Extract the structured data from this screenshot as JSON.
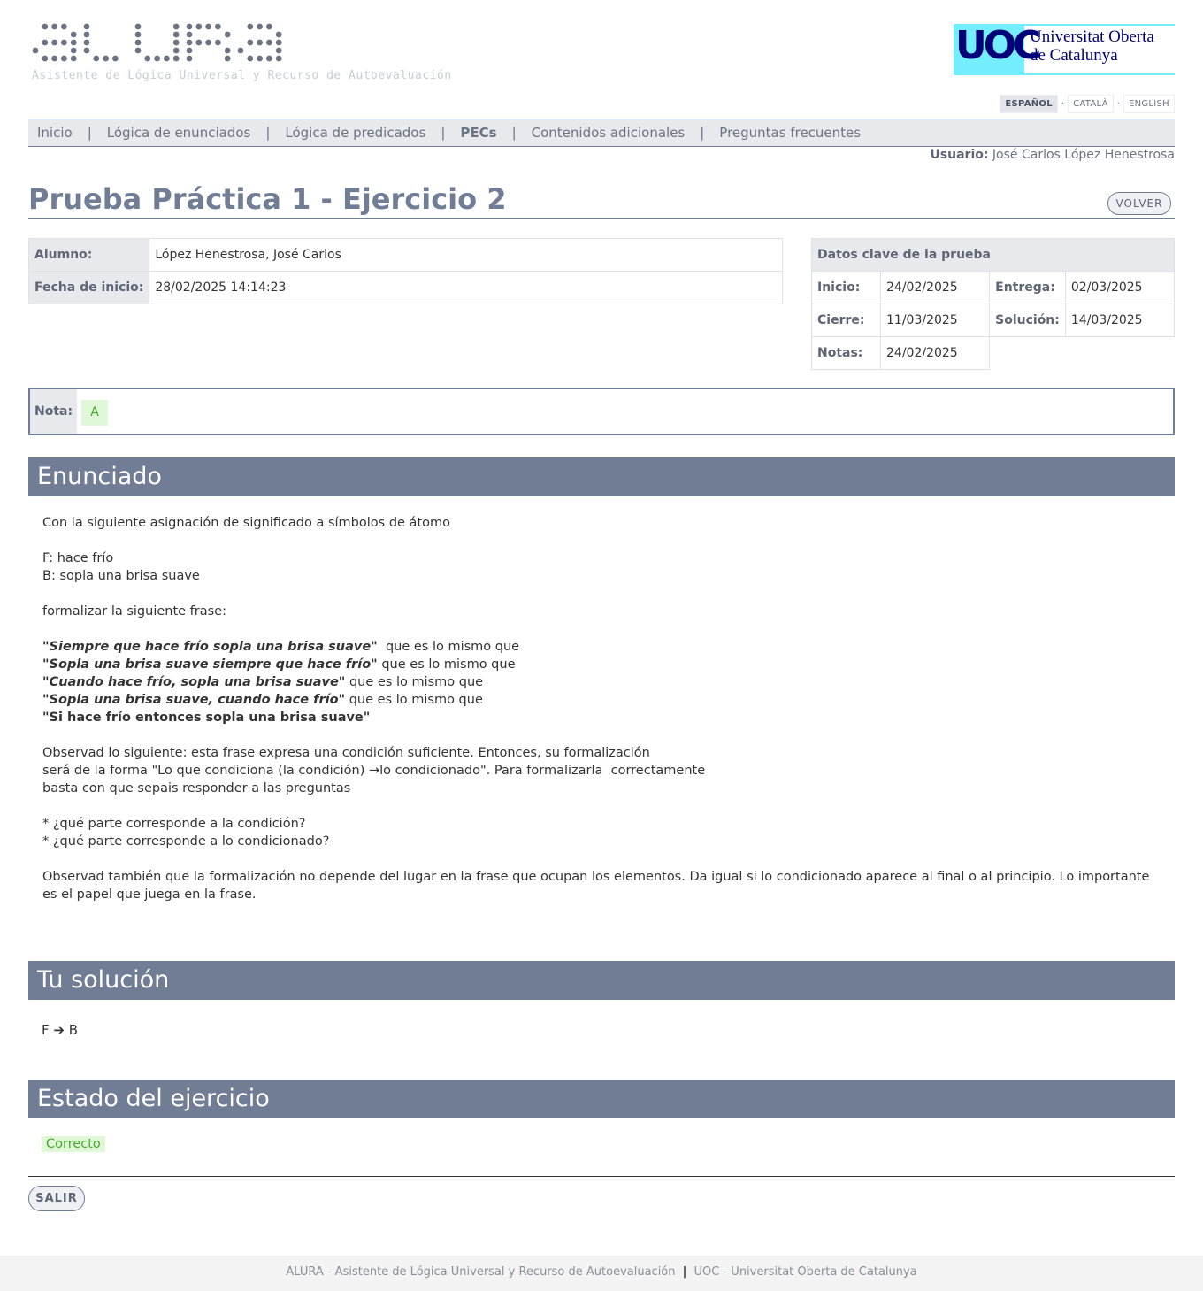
{
  "header": {
    "logo_text": "ALURA",
    "logo_subtitle": "Asistente de Lógica Universal y Recurso de Autoevaluación",
    "uoc_mark": "UOC",
    "uoc_name_line1": "Universitat Oberta",
    "uoc_name_line2": "de Catalunya",
    "languages": [
      "ESPAÑOL",
      "CATALÀ",
      "ENGLISH"
    ],
    "active_language": "ESPAÑOL"
  },
  "nav": {
    "items": [
      "Inicio",
      "Lógica de enunciados",
      "Lógica de predicados",
      "PECs",
      "Contenidos adicionales",
      "Preguntas frecuentes"
    ],
    "active": "PECs",
    "separator": "|"
  },
  "user": {
    "label": "Usuario:",
    "name": "José Carlos López Henestrosa"
  },
  "page": {
    "title": "Prueba Práctica 1 - Ejercicio 2",
    "back_button": "VOLVER",
    "exit_button": "SALIR"
  },
  "student": {
    "name_label": "Alumno:",
    "name": "López Henestrosa, José Carlos",
    "start_label": "Fecha de inicio:",
    "start": "28/02/2025 14:14:23"
  },
  "key_data": {
    "heading": "Datos clave de la prueba",
    "inicio_label": "Inicio:",
    "inicio": "24/02/2025",
    "entrega_label": "Entrega:",
    "entrega": "02/03/2025",
    "cierre_label": "Cierre:",
    "cierre": "11/03/2025",
    "solucion_label": "Solución:",
    "solucion": "14/03/2025",
    "notas_label": "Notas:",
    "notas": "24/02/2025"
  },
  "grade": {
    "label": "Nota:",
    "value": "A"
  },
  "sections": {
    "statement": "Enunciado",
    "solution": "Tu solución",
    "status": "Estado del ejercicio"
  },
  "statement": {
    "intro": "Con la siguiente asignación de significado a símbolos de átomo",
    "atom_f": "F: hace frío",
    "atom_b": "B: sopla una brisa suave",
    "formalize": "formalizar la siguiente frase:",
    "phrase1": "\"Siempre que hace frío sopla una brisa suave\"",
    "phrase1_tail": "  que es lo mismo que",
    "phrase2": "\"Sopla una brisa suave siempre que hace frío\"",
    "phrase2_tail": " que es lo mismo que",
    "phrase3": "\"Cuando hace frío, sopla una brisa suave\"",
    "phrase3_tail": " que es lo mismo que",
    "phrase4": "\"Sopla una brisa suave, cuando hace frío\"",
    "phrase4_tail": " que es lo mismo que",
    "phrase5": "\"Si hace frío entonces sopla una brisa suave\"",
    "obs1_line1": "Observad lo siguiente: esta frase expresa una condición suficiente. Entonces, su formalización",
    "obs1_line2_a": "será de la forma \"Lo que condiciona (la condición) ",
    "arrow": "→",
    "obs1_line2_b": "lo condicionado\". Para formalizarla  correctamente",
    "obs1_line3": "basta con que sepais responder a las preguntas",
    "q1": "* ¿qué parte corresponde a la condición?",
    "q2": "* ¿qué parte corresponde a lo condicionado?",
    "obs2": "Observad también que la formalización no depende del lugar en la frase que ocupan los elementos. Da igual si lo condicionado aparece al final o al principio. Lo importante es el papel que juega en la frase."
  },
  "solution": {
    "left": "F",
    "arrow": "➔",
    "right": "B"
  },
  "status": {
    "value": "Correcto"
  },
  "footer": {
    "left": "ALURA - Asistente de Lógica Universal y Recurso de Autoevaluación",
    "sep": "|",
    "right": "UOC - Universitat Oberta de Catalunya"
  },
  "colors": {
    "accent": "#707d94",
    "success_bg": "#e0f8d8",
    "success_text": "#45a82e",
    "uoc_cyan": "#73edff",
    "uoc_navy": "#000078"
  }
}
